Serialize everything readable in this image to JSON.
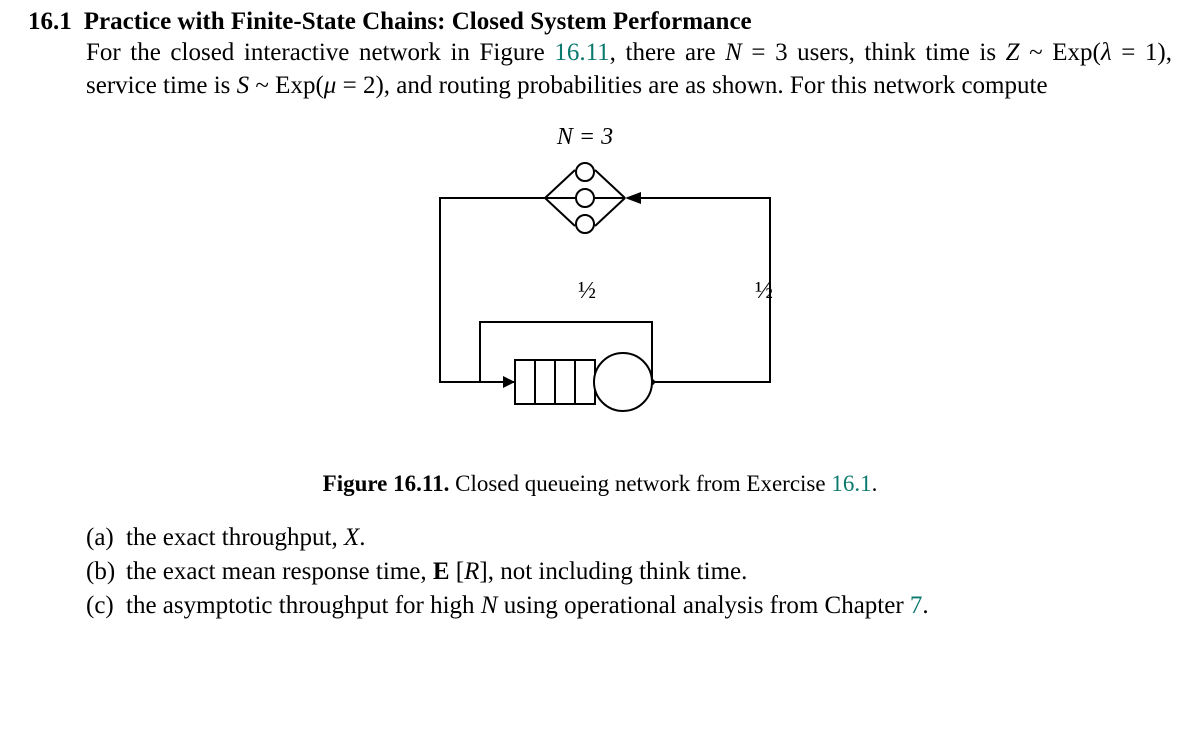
{
  "heading": {
    "num": "16.1",
    "title": "Practice with Finite-State Chains: Closed System Performance"
  },
  "para": {
    "t1": "For the closed interactive network in Figure ",
    "figref1": "16.11",
    "t2": ", there are ",
    "N": "N",
    "eq3": " = 3 users, think time is ",
    "Z": "Z",
    "tilde1": " ~ Exp(",
    "lambda": "λ",
    "eq1": " = 1), service time is ",
    "S": "S",
    "tilde2": " ~ Exp(",
    "mu": "μ",
    "eq2": " = 2), and routing probabilities are as shown. For this network compute"
  },
  "figure": {
    "N_label": "N = 3",
    "half1": "½",
    "half2": "½",
    "caption_label": "Figure 16.11.",
    "caption_text": " Closed queueing network from Exercise ",
    "caption_ref": "16.1",
    "caption_end": "."
  },
  "list": {
    "a_marker": "(a)",
    "a_t1": "the exact throughput, ",
    "a_X": "X",
    "a_t2": ".",
    "b_marker": "(b)",
    "b_t1": "the exact mean response time, ",
    "b_E": "E",
    "b_open": " [",
    "b_R": "R",
    "b_close": "], not including think time.",
    "c_marker": "(c)",
    "c_t1": "the asymptotic throughput for high ",
    "c_N": "N",
    "c_t2": " using operational analysis from Chapter ",
    "c_ref": "7",
    "c_t3": "."
  }
}
